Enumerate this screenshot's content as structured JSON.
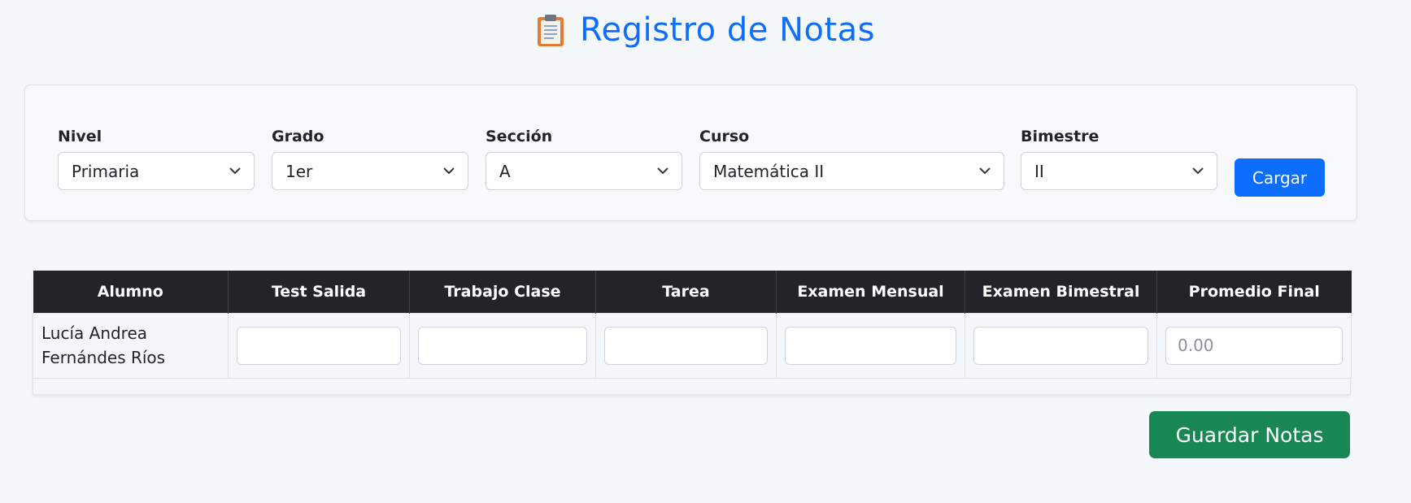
{
  "header": {
    "title": "Registro de Notas",
    "icon": "clipboard-icon"
  },
  "filters": {
    "nivel": {
      "label": "Nivel",
      "value": "Primaria"
    },
    "grado": {
      "label": "Grado",
      "value": "1er"
    },
    "seccion": {
      "label": "Sección",
      "value": "A"
    },
    "curso": {
      "label": "Curso",
      "value": "Matemática II"
    },
    "bimestre": {
      "label": "Bimestre",
      "value": "II"
    },
    "load_button": "Cargar"
  },
  "table": {
    "columns": [
      "Alumno",
      "Test Salida",
      "Trabajo Clase",
      "Tarea",
      "Examen Mensual",
      "Examen Bimestral",
      "Promedio Final"
    ],
    "rows": [
      {
        "student_line1": "Lucía Andrea",
        "student_line2": "Fernándes Ríos",
        "test_salida": "",
        "trabajo_clase": "",
        "tarea": "",
        "examen_mensual": "",
        "examen_bimestral": "",
        "promedio_final_placeholder": "0.00"
      }
    ]
  },
  "save_button": "Guardar Notas",
  "colors": {
    "primary": "#0d6efd",
    "success": "#198754",
    "header_dark": "#212529",
    "background": "#f5f8fb"
  }
}
